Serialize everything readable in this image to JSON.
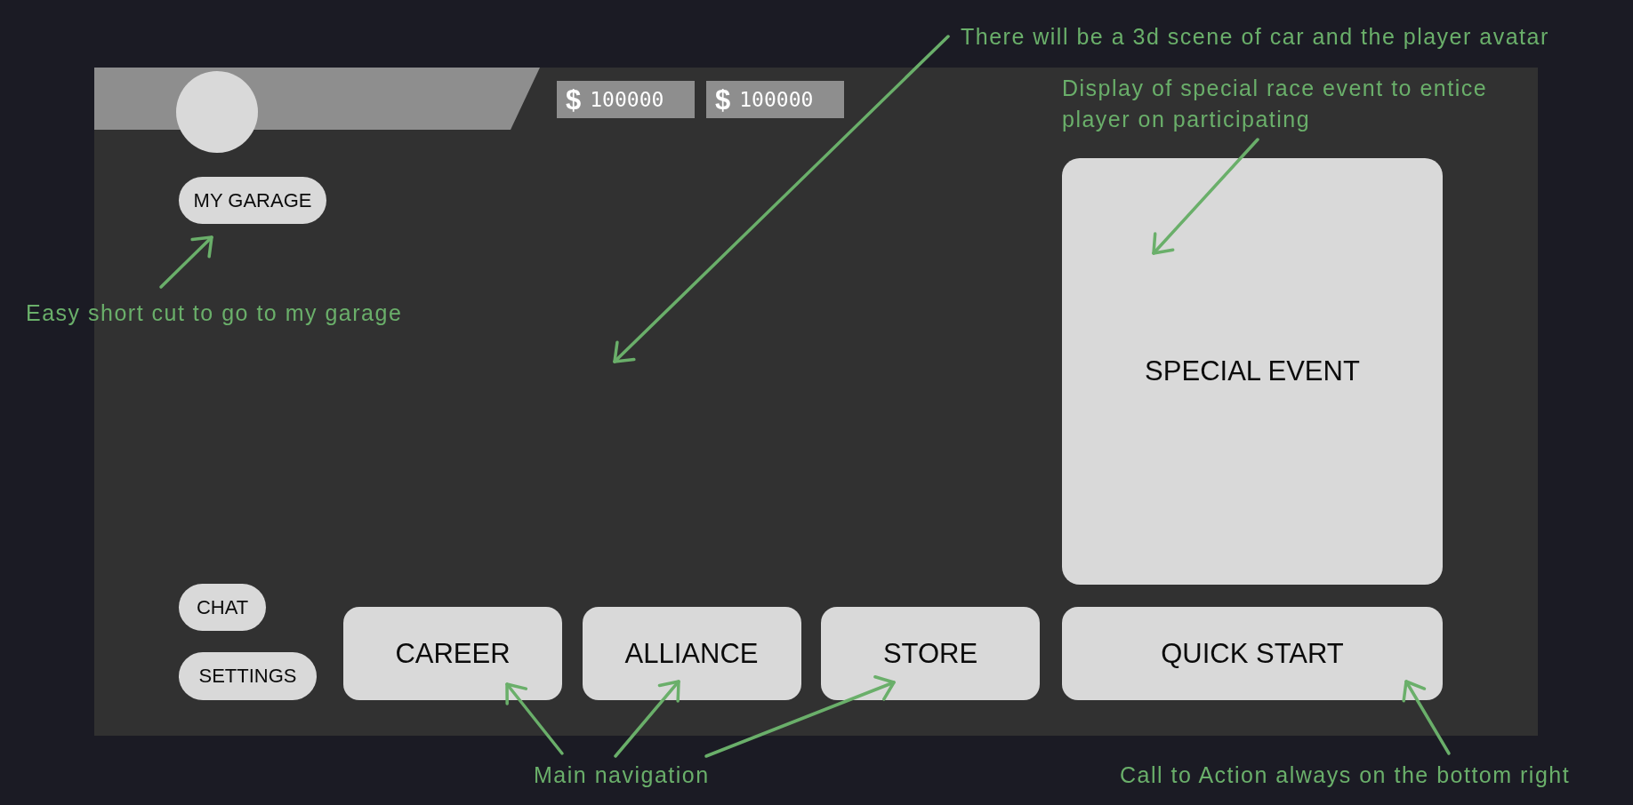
{
  "mockup": {
    "currencies": [
      {
        "symbol": "$",
        "amount": "100000"
      },
      {
        "symbol": "$",
        "amount": "100000"
      }
    ],
    "shortcut_button": "MY GARAGE",
    "special_event": {
      "label": "SPECIAL EVENT"
    },
    "side_buttons": [
      "CHAT",
      "SETTINGS"
    ],
    "main_nav": [
      "CAREER",
      "ALLIANCE",
      "STORE"
    ],
    "cta_button": "QUICK START"
  },
  "annotations": [
    {
      "text": "There will be a 3d scene of car and the player avatar"
    },
    {
      "text": "Display of special race event to entice player on participating"
    },
    {
      "text": "Easy short cut to go to my garage"
    },
    {
      "text": "Main navigation"
    },
    {
      "text": "Call to Action always on the bottom right"
    }
  ]
}
